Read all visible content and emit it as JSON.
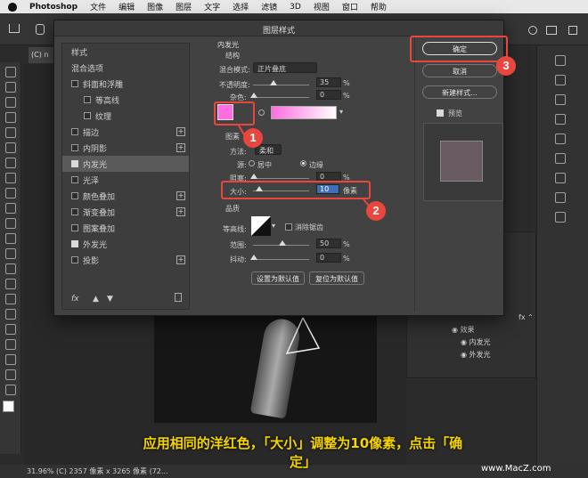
{
  "menubar": {
    "app": "Photoshop",
    "items": [
      "文件",
      "编辑",
      "图像",
      "图层",
      "文字",
      "选择",
      "滤镜",
      "3D",
      "视图",
      "窗口",
      "帮助"
    ]
  },
  "doc_tab": "(C) n",
  "dialog": {
    "title": "图层样式",
    "styles_header": "样式",
    "blend_options": "混合选项",
    "items": [
      {
        "label": "斜面和浮雕",
        "checked": false,
        "plus": false
      },
      {
        "label": "等高线",
        "checked": false,
        "plus": false
      },
      {
        "label": "纹理",
        "checked": false,
        "plus": false
      },
      {
        "label": "描边",
        "checked": false,
        "plus": true
      },
      {
        "label": "内阴影",
        "checked": false,
        "plus": true
      },
      {
        "label": "内发光",
        "checked": true,
        "plus": false,
        "selected": true
      },
      {
        "label": "光泽",
        "checked": false,
        "plus": false
      },
      {
        "label": "颜色叠加",
        "checked": false,
        "plus": true
      },
      {
        "label": "渐变叠加",
        "checked": false,
        "plus": true
      },
      {
        "label": "图案叠加",
        "checked": false,
        "plus": false
      },
      {
        "label": "外发光",
        "checked": true,
        "plus": false
      },
      {
        "label": "投影",
        "checked": false,
        "plus": true
      }
    ],
    "fx": "fx",
    "panel": {
      "section": "内发光",
      "structure": "结构",
      "blend_mode_label": "混合模式:",
      "blend_mode_value": "正片叠底",
      "opacity_label": "不透明度:",
      "opacity_value": "35",
      "noise_label": "杂色:",
      "noise_value": "0",
      "percent": "%",
      "elements": "图素",
      "method_label": "方法:",
      "method_value": "柔和",
      "source_label": "源:",
      "source_center": "居中",
      "source_edge": "边缘",
      "choke_label": "阻塞:",
      "choke_value": "0",
      "size_label": "大小:",
      "size_value": "10",
      "size_unit": "像素",
      "quality": "品质",
      "contour_label": "等高线:",
      "antialias_label": "消除锯齿",
      "range_label": "范围:",
      "range_value": "50",
      "jitter_label": "抖动:",
      "jitter_value": "0",
      "set_default": "设置为默认值",
      "reset_default": "复位为默认值",
      "glow_color": "#ff6de0"
    },
    "buttons": {
      "ok": "确定",
      "cancel": "取消",
      "new_style": "新建样式...",
      "preview": "预览"
    }
  },
  "layers": {
    "effects": "效果",
    "inner_glow": "内发光",
    "outer_glow": "外发光"
  },
  "status": "31.96%    (C) 2357 像素 x 3265 像素 (72...",
  "badges": [
    "1",
    "2",
    "3"
  ],
  "caption": "应用相同的洋红色，「大小」调整为10像素，点击「确定」",
  "watermark": "www.MacZ.com"
}
